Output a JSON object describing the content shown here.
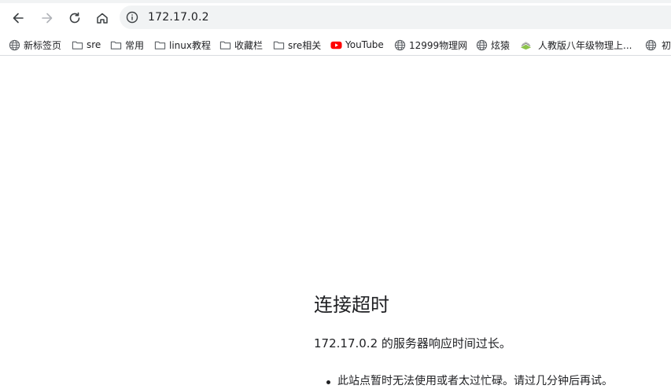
{
  "browser": {
    "url": "172.17.0.2",
    "nav": {
      "back_icon": "back-arrow-icon",
      "forward_icon": "forward-arrow-icon",
      "reload_icon": "reload-icon",
      "home_icon": "home-icon"
    }
  },
  "bookmarks": [
    {
      "label": "新标签页",
      "icon": "globe-icon"
    },
    {
      "label": "sre",
      "icon": "folder-icon"
    },
    {
      "label": "常用",
      "icon": "folder-icon"
    },
    {
      "label": "linux教程",
      "icon": "folder-icon"
    },
    {
      "label": "收藏栏",
      "icon": "folder-icon"
    },
    {
      "label": "sre相关",
      "icon": "folder-icon"
    },
    {
      "label": "YouTube",
      "icon": "youtube-icon"
    },
    {
      "label": "12999物理网",
      "icon": "globe-icon"
    },
    {
      "label": "炫猿",
      "icon": "globe-icon"
    },
    {
      "label": "人教版八年级物理上...",
      "icon": "book-icon"
    },
    {
      "label": "初",
      "icon": "globe-icon"
    }
  ],
  "error": {
    "title": "连接超时",
    "description": "172.17.0.2 的服务器响应时间过长。",
    "suggestions": [
      "此站点暂时无法使用或者太过忙碌。请过几分钟后再试。"
    ]
  },
  "colors": {
    "youtube_red": "#ff0000",
    "text": "#202124",
    "omnibox_bg": "#f1f3f4"
  }
}
